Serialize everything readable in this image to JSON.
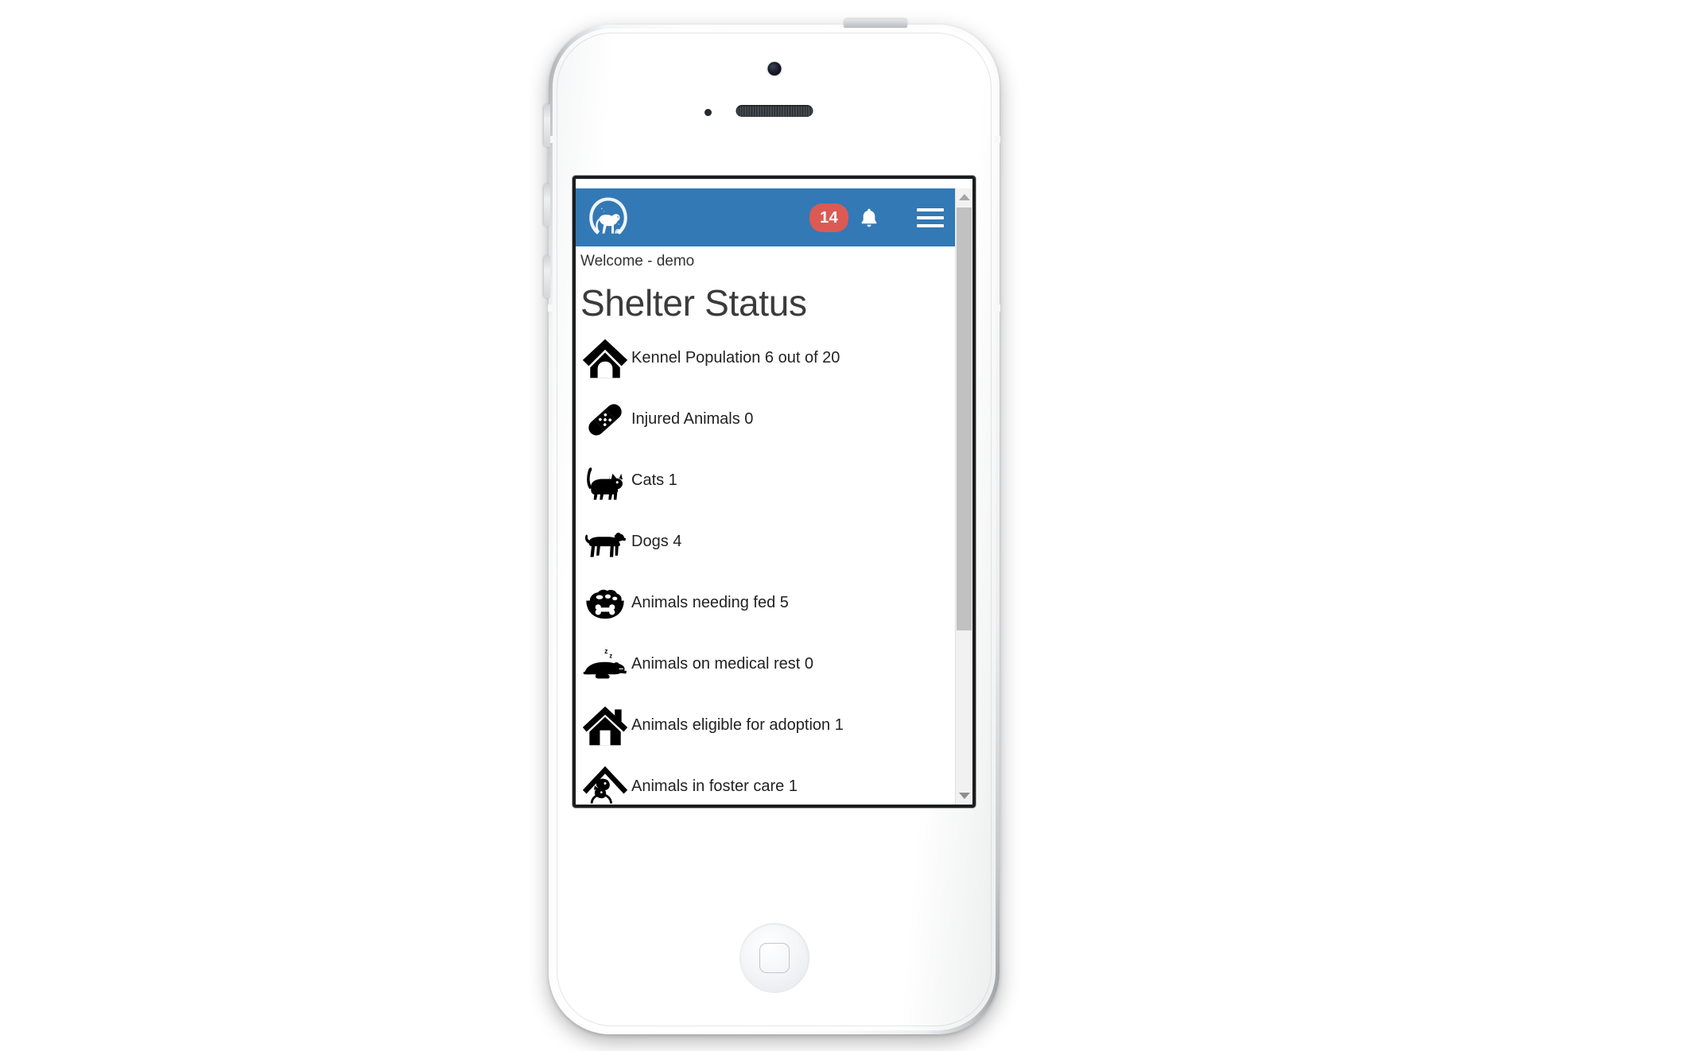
{
  "device": {
    "name": "iphone-5-white",
    "camera": "front-camera",
    "speaker": "earpiece-speaker",
    "sensor": "proximity-sensor",
    "home_button": "home-button",
    "power_button": "power-button",
    "side_buttons": [
      "mute-switch",
      "volume-up",
      "volume-down"
    ]
  },
  "navbar": {
    "logo_alt": "shelter-logo",
    "notification_count": "14",
    "bell_icon": "bell-icon",
    "menu_icon": "hamburger-menu-icon"
  },
  "page": {
    "welcome": "Welcome - demo",
    "title": "Shelter Status"
  },
  "status_items": [
    {
      "icon": "dog-house-icon",
      "label": "Kennel Population 6 out of 20"
    },
    {
      "icon": "bandage-icon",
      "label": "Injured Animals 0"
    },
    {
      "icon": "cat-icon",
      "label": "Cats 1"
    },
    {
      "icon": "dog-icon",
      "label": "Dogs 4"
    },
    {
      "icon": "food-bowl-icon",
      "label": "Animals needing fed 5"
    },
    {
      "icon": "sleeping-dog-icon",
      "label": "Animals on medical rest 0"
    },
    {
      "icon": "house-icon",
      "label": "Animals eligible for adoption 1"
    },
    {
      "icon": "foster-home-icon",
      "label": "Animals in foster care 1"
    }
  ],
  "scrollbar": {
    "up_arrow": "scroll-up-arrow",
    "down_arrow": "scroll-down-arrow",
    "thumb": "scroll-thumb"
  },
  "colors": {
    "navbar_blue": "#3379b5",
    "badge_red": "#dc5a53",
    "page_background": "#ffffff",
    "text": "#333333"
  }
}
